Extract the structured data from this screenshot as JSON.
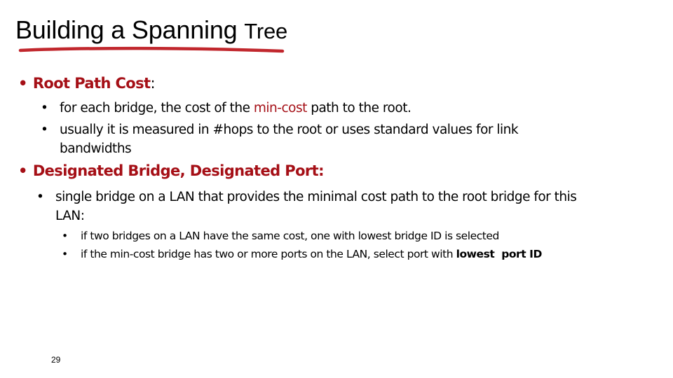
{
  "slide": {
    "title_main": "Building a Spanning",
    "title_tail": "Tree",
    "accent_color": "#a50f16",
    "page_number": "29"
  },
  "sections": [
    {
      "heading": "Root Path Cost",
      "heading_suffix": ":",
      "items": [
        {
          "pre": "for each bridge, the cost of the ",
          "highlight": "min-cost",
          "post": " path to the root."
        },
        {
          "text": "usually it is measured in #hops to the root or uses standard values for link bandwidths"
        }
      ]
    },
    {
      "heading": "Designated Bridge, Designated Port",
      "heading_suffix": ":",
      "items": [
        {
          "text": "single bridge on a LAN that provides the minimal cost path to the root bridge for this LAN:"
        }
      ],
      "subitems": [
        {
          "text": "if two bridges on a LAN have the same cost, one with lowest bridge ID is selected"
        },
        {
          "pre": "if the min-cost bridge has two or more ports on the LAN, select port with ",
          "bold": "lowest  port ID"
        }
      ]
    }
  ],
  "bullet_glyph": "•"
}
